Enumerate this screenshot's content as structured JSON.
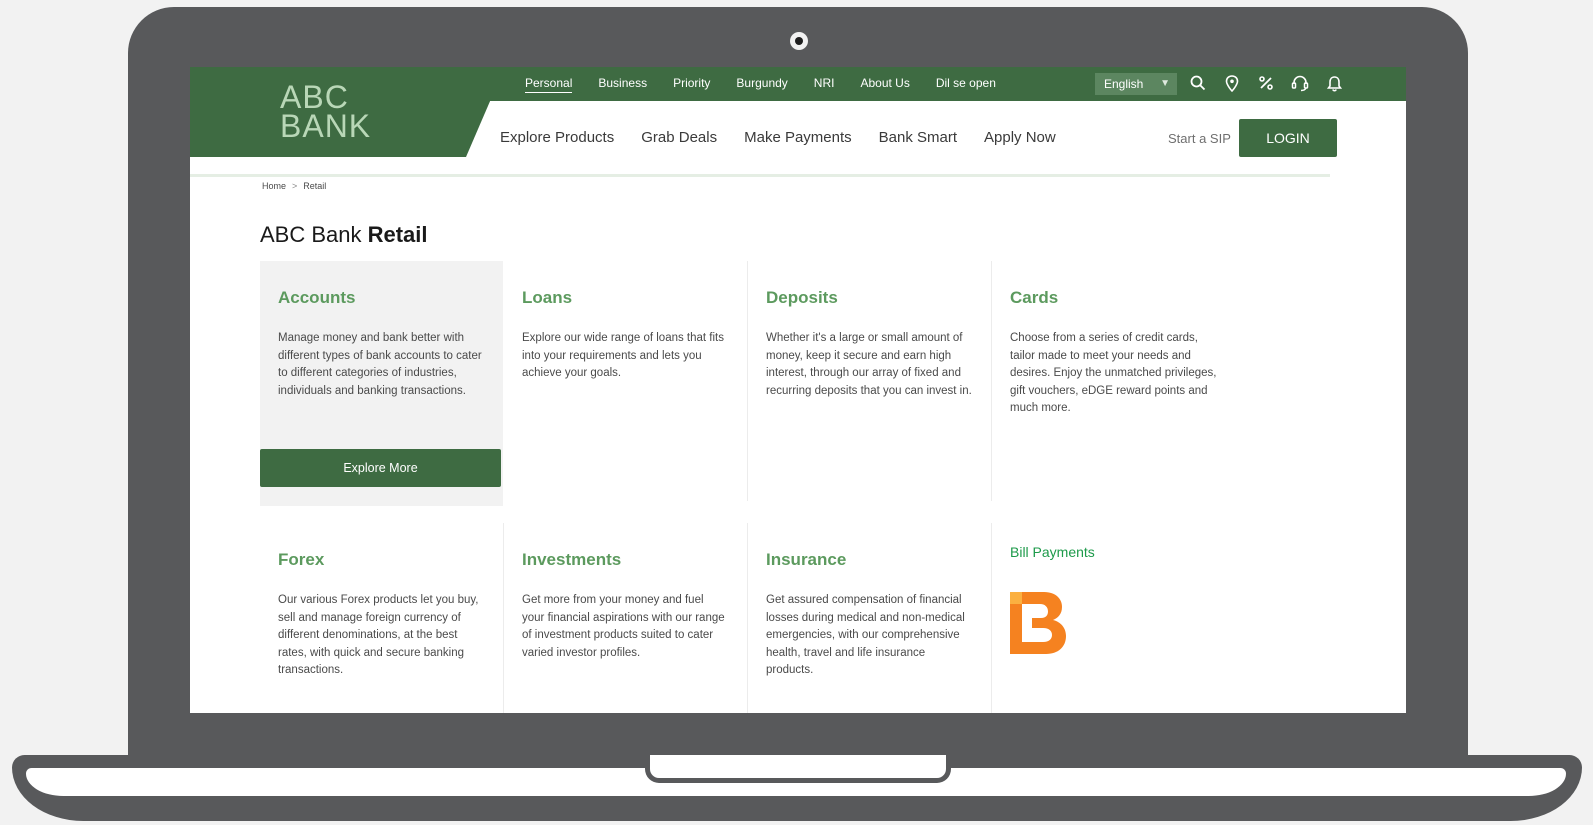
{
  "brand": {
    "line1": "ABC",
    "line2": "BANK"
  },
  "top_nav": [
    "Personal",
    "Business",
    "Priority",
    "Burgundy",
    "NRI",
    "About Us",
    "Dil se open"
  ],
  "language": {
    "selected": "English"
  },
  "icons": [
    "search-icon",
    "location-icon",
    "offers-icon",
    "support-icon",
    "bell-icon"
  ],
  "secondary_nav": [
    "Explore Products",
    "Grab Deals",
    "Make Payments",
    "Bank Smart",
    "Apply Now"
  ],
  "start_sip": "Start a SIP",
  "login_label": "LOGIN",
  "breadcrumb": {
    "home": "Home",
    "arrow": ">",
    "current": "Retail"
  },
  "page_title": {
    "prefix": "ABC Bank ",
    "bold": "Retail"
  },
  "cards": [
    {
      "title": "Accounts",
      "desc": "Manage money and bank better with different types of bank accounts to cater to different categories of industries, individuals and banking transactions."
    },
    {
      "title": "Loans",
      "desc": "Explore our wide range of loans that fits into your requirements and lets you achieve your goals."
    },
    {
      "title": "Deposits",
      "desc": "Whether it's a large or small amount of money, keep it secure and earn high interest, through our array of fixed and recurring deposits that you can invest in."
    },
    {
      "title": "Cards",
      "desc": "Choose from a series of credit cards, tailor made to meet your needs and desires. Enjoy the unmatched privileges, gift vouchers, eDGE reward points and much more."
    },
    {
      "title": "Forex",
      "desc": "Our various Forex products let you buy, sell and manage foreign currency of different denominations, at the best rates, with quick and secure banking transactions."
    },
    {
      "title": "Investments",
      "desc": "Get more from your money and fuel your financial aspirations with our range of investment products suited to cater varied investor profiles."
    },
    {
      "title": "Insurance",
      "desc": "Get assured compensation of financial losses during medical and non-medical emergencies, with our comprehensive health, travel and life insurance products."
    }
  ],
  "explore_more": "Explore More",
  "bill_payments": "Bill Payments",
  "colors": {
    "brand_green": "#3e6b42",
    "title_green": "#5c9a5e",
    "bill_green": "#1d9a4a",
    "bbps_orange": "#f58220"
  }
}
